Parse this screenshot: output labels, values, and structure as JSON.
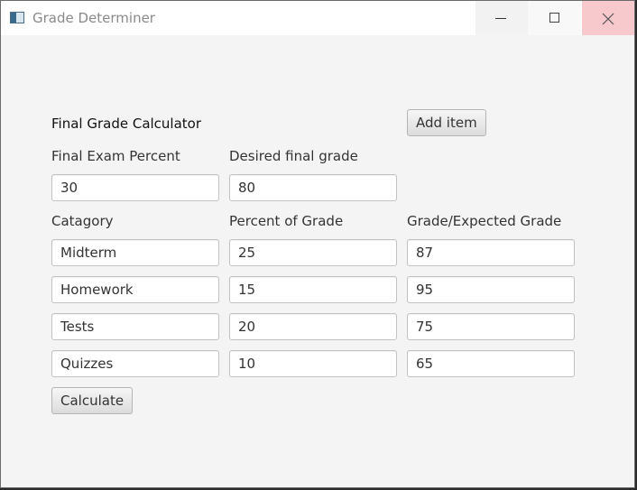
{
  "window": {
    "title": "Grade Determiner"
  },
  "form": {
    "heading": "Final Grade Calculator",
    "add_item_label": "Add item",
    "final_exam_percent_label": "Final Exam Percent",
    "desired_final_grade_label": "Desired final grade",
    "final_exam_percent_value": "30",
    "desired_final_grade_value": "80",
    "columns": {
      "category": "Catagory",
      "percent": "Percent of Grade",
      "grade": "Grade/Expected Grade"
    },
    "rows": [
      {
        "category": "Midterm",
        "percent": "25",
        "grade": "87"
      },
      {
        "category": "Homework",
        "percent": "15",
        "grade": "95"
      },
      {
        "category": "Tests",
        "percent": "20",
        "grade": "75"
      },
      {
        "category": "Quizzes",
        "percent": "10",
        "grade": "65"
      }
    ],
    "calculate_label": "Calculate"
  }
}
